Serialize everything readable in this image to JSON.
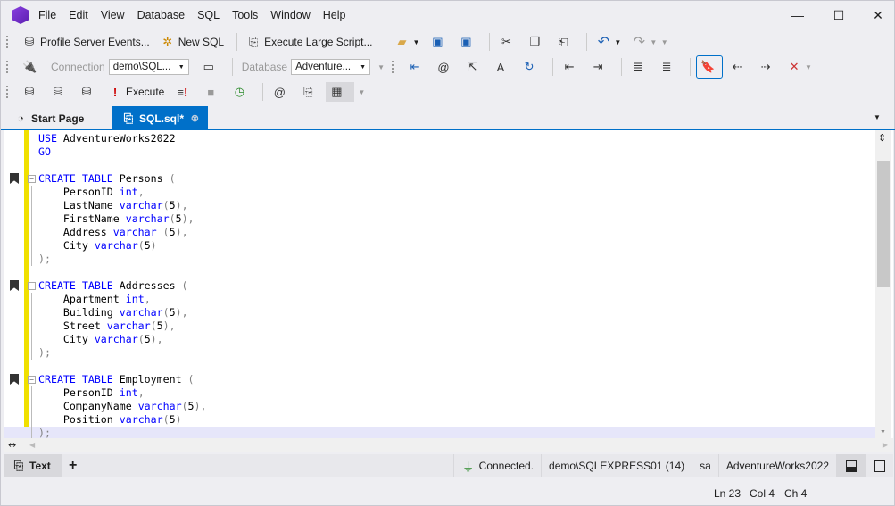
{
  "app": {
    "menu": [
      "File",
      "Edit",
      "View",
      "Database",
      "SQL",
      "Tools",
      "Window",
      "Help"
    ],
    "window_controls": {
      "minimize": "—",
      "maximize": "☐",
      "close": "✕"
    }
  },
  "toolbar1": {
    "profile": "Profile Server Events...",
    "new_sql": "New SQL",
    "execute_large": "Execute Large Script..."
  },
  "toolbar2": {
    "connection_label": "Connection",
    "connection_value": "demo\\SQL...",
    "database_label": "Database",
    "database_value": "Adventure..."
  },
  "toolbar3": {
    "execute": "Execute"
  },
  "tabs": [
    {
      "label": "Start Page",
      "active": false
    },
    {
      "label": "SQL.sql*",
      "active": true
    }
  ],
  "code": [
    {
      "t": [
        [
          "kw",
          "USE"
        ],
        [
          "id",
          " AdventureWorks2022"
        ]
      ]
    },
    {
      "t": [
        [
          "kw",
          "GO"
        ]
      ]
    },
    {
      "t": []
    },
    {
      "bm": true,
      "fold": true,
      "t": [
        [
          "kw",
          "CREATE TABLE"
        ],
        [
          "id",
          " Persons "
        ],
        [
          "pn",
          "("
        ]
      ]
    },
    {
      "t": [
        [
          "id",
          "    PersonID "
        ],
        [
          "kw",
          "int"
        ],
        [
          "pn",
          ","
        ]
      ]
    },
    {
      "t": [
        [
          "id",
          "    LastName "
        ],
        [
          "kw",
          "varchar"
        ],
        [
          "pn",
          "("
        ],
        [
          "num",
          "5"
        ],
        [
          "pn",
          "),"
        ]
      ]
    },
    {
      "t": [
        [
          "id",
          "    FirstName "
        ],
        [
          "kw",
          "varchar"
        ],
        [
          "pn",
          "("
        ],
        [
          "num",
          "5"
        ],
        [
          "pn",
          "),"
        ]
      ]
    },
    {
      "t": [
        [
          "id",
          "    Address "
        ],
        [
          "kw",
          "varchar"
        ],
        [
          "pn",
          " ("
        ],
        [
          "num",
          "5"
        ],
        [
          "pn",
          "),"
        ]
      ]
    },
    {
      "t": [
        [
          "id",
          "    City "
        ],
        [
          "kw",
          "varchar"
        ],
        [
          "pn",
          "("
        ],
        [
          "num",
          "5"
        ],
        [
          "pn",
          ")"
        ]
      ]
    },
    {
      "t": [
        [
          "pn",
          ");"
        ]
      ]
    },
    {
      "t": []
    },
    {
      "bm": true,
      "fold": true,
      "t": [
        [
          "kw",
          "CREATE TABLE"
        ],
        [
          "id",
          " Addresses "
        ],
        [
          "pn",
          "("
        ]
      ]
    },
    {
      "t": [
        [
          "id",
          "    Apartment "
        ],
        [
          "kw",
          "int"
        ],
        [
          "pn",
          ","
        ]
      ]
    },
    {
      "t": [
        [
          "id",
          "    Building "
        ],
        [
          "kw",
          "varchar"
        ],
        [
          "pn",
          "("
        ],
        [
          "num",
          "5"
        ],
        [
          "pn",
          "),"
        ]
      ]
    },
    {
      "t": [
        [
          "id",
          "    Street "
        ],
        [
          "kw",
          "varchar"
        ],
        [
          "pn",
          "("
        ],
        [
          "num",
          "5"
        ],
        [
          "pn",
          "),"
        ]
      ]
    },
    {
      "t": [
        [
          "id",
          "    City "
        ],
        [
          "kw",
          "varchar"
        ],
        [
          "pn",
          "("
        ],
        [
          "num",
          "5"
        ],
        [
          "pn",
          "),"
        ]
      ]
    },
    {
      "t": [
        [
          "pn",
          ");"
        ]
      ]
    },
    {
      "t": []
    },
    {
      "bm": true,
      "fold": true,
      "t": [
        [
          "kw",
          "CREATE TABLE"
        ],
        [
          "id",
          " Employment "
        ],
        [
          "pn",
          "("
        ]
      ]
    },
    {
      "t": [
        [
          "id",
          "    PersonID "
        ],
        [
          "kw",
          "int"
        ],
        [
          "pn",
          ","
        ]
      ]
    },
    {
      "t": [
        [
          "id",
          "    CompanyName "
        ],
        [
          "kw",
          "varchar"
        ],
        [
          "pn",
          "("
        ],
        [
          "num",
          "5"
        ],
        [
          "pn",
          "),"
        ]
      ]
    },
    {
      "t": [
        [
          "id",
          "    Position "
        ],
        [
          "kw",
          "varchar"
        ],
        [
          "pn",
          "("
        ],
        [
          "num",
          "5"
        ],
        [
          "pn",
          ")"
        ]
      ]
    },
    {
      "cur": true,
      "t": [
        [
          "pn",
          ");"
        ]
      ]
    }
  ],
  "bottombar": {
    "text_tab": "Text",
    "add": "+",
    "status": "Connected.",
    "server": "demo\\SQLEXPRESS01 (14)",
    "user": "sa",
    "database": "AdventureWorks2022"
  },
  "statusline": {
    "ln": "Ln 23",
    "col": "Col 4",
    "ch": "Ch 4"
  },
  "colors": {
    "accent": "#0070c9",
    "keyword": "#0000ff",
    "change_marker": "#f0e000",
    "current_line": "#e6e6fa"
  }
}
